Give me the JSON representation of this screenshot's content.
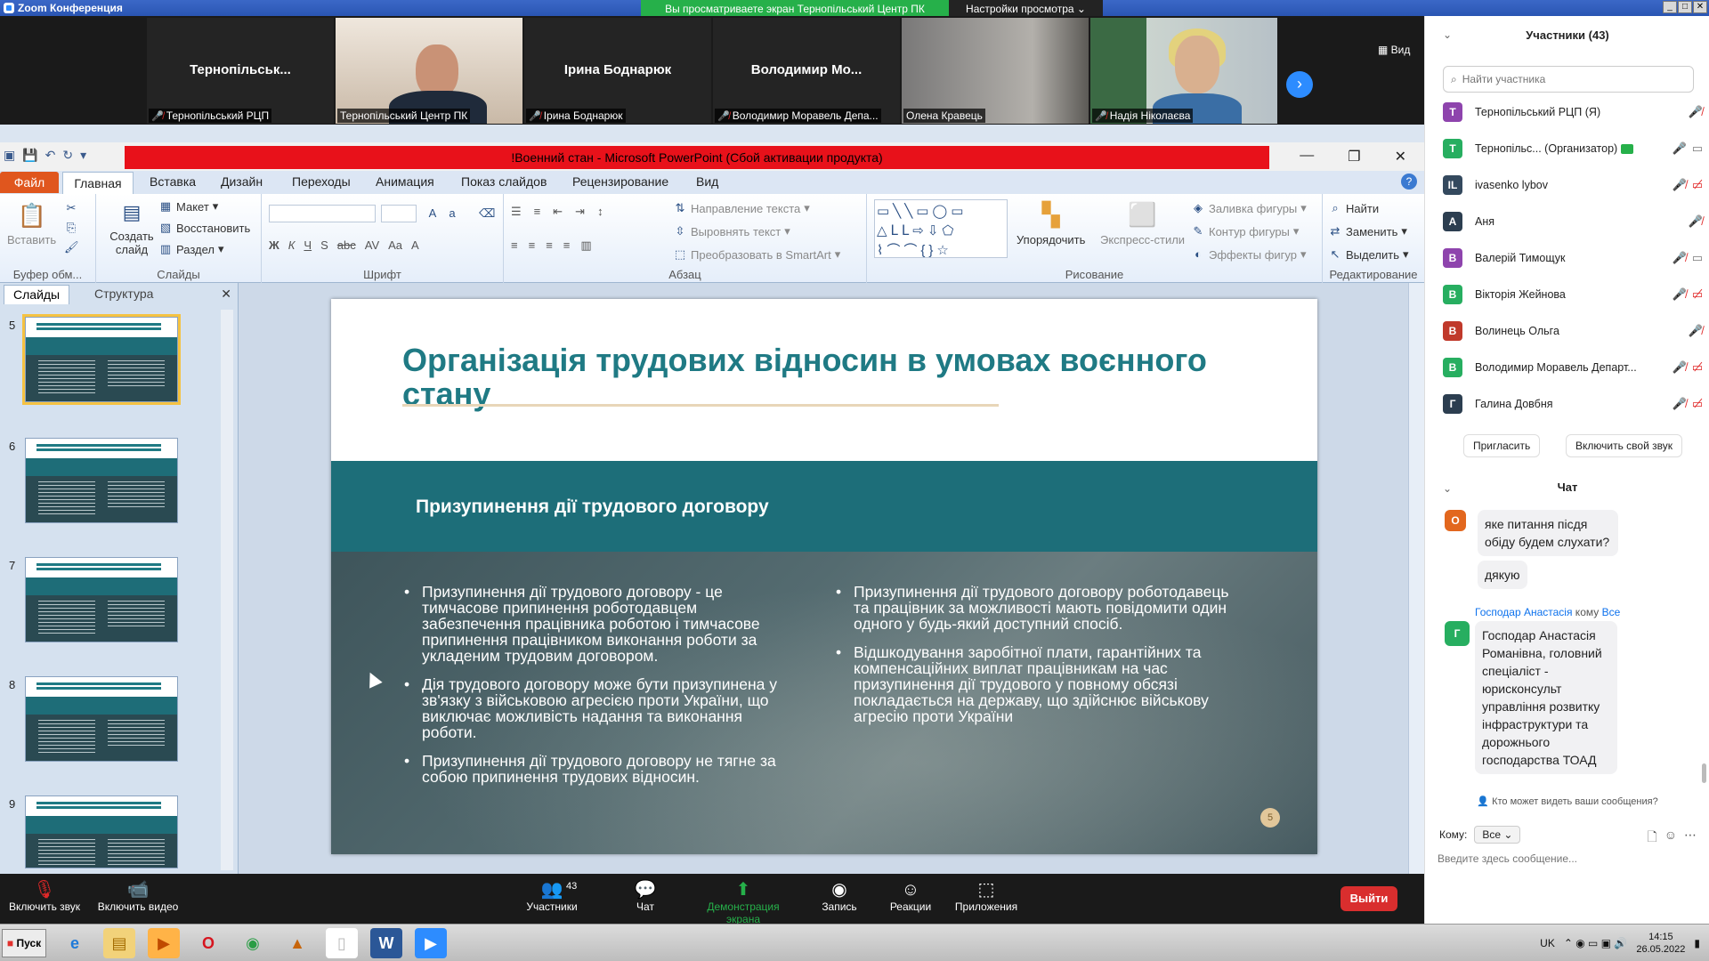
{
  "zoom": {
    "window_title": "Zoom Конференция",
    "share_banner": "Вы просматриваете экран Тернопільський Центр ПК",
    "view_options": "Настройки просмотра ⌄",
    "view_button": "Вид"
  },
  "video_tiles": [
    {
      "display_name": "Тернопільськ...",
      "label": "Тернопільський РЦП",
      "muted": true
    },
    {
      "display_name": "",
      "label": "Тернопільський Центр ПК",
      "muted": false
    },
    {
      "display_name": "Ірина Боднарюк",
      "label": "Ірина Боднарюк",
      "muted": true
    },
    {
      "display_name": "Володимир  Мо...",
      "label": "Володимир Моравель Депа...",
      "muted": true
    },
    {
      "display_name": "",
      "label": "Олена Кравець",
      "muted": false
    },
    {
      "display_name": "",
      "label": "Надія Ніколаєва",
      "muted": true
    }
  ],
  "ppt": {
    "title": "!Военний стан  -  Microsoft PowerPoint (Сбой активации продукта)",
    "tabs": [
      "Файл",
      "Главная",
      "Вставка",
      "Дизайн",
      "Переходы",
      "Анимация",
      "Показ слайдов",
      "Рецензирование",
      "Вид"
    ],
    "ribbon": {
      "clipboard": {
        "paste": "Вставить",
        "label": "Буфер обм..."
      },
      "slides": {
        "new_slide": "Создать слайд",
        "layout": "Макет",
        "reset": "Восстановить",
        "section": "Раздел",
        "label": "Слайды"
      },
      "font": {
        "label": "Шрифт"
      },
      "paragraph": {
        "text_direction": "Направление текста",
        "align_text": "Выровнять текст",
        "smartart": "Преобразовать в SmartArt",
        "label": "Абзац"
      },
      "drawing": {
        "arrange": "Упорядочить",
        "quick_styles": "Экспресс-стили",
        "shape_fill": "Заливка фигуры",
        "shape_outline": "Контур фигуры",
        "shape_effects": "Эффекты фигур",
        "label": "Рисование"
      },
      "editing": {
        "find": "Найти",
        "replace": "Заменить",
        "select": "Выделить",
        "label": "Редактирование"
      }
    },
    "pane": {
      "tab_slides": "Слайды",
      "tab_outline": "Структура",
      "close": "✕"
    },
    "thumbnails": [
      "5",
      "6",
      "7",
      "8",
      "9"
    ],
    "slide": {
      "title": "Організація трудових відносин в умовах воєнного стану",
      "subtitle": "Призупинення дії трудового договору",
      "left_bullets": [
        "Призупинення  дії трудового договору - це тимчасове припинення  роботодавцем забезпечення працівника роботою і тимчасове припинення  працівником виконання роботи за укладеним  трудовим договором.",
        "Дія трудового договору може бути призупинена  у зв'язку з військовою агресією проти України, що виключає можливість надання та виконання роботи.",
        "Призупинення  дії трудового договору не тягне за собою припинення  трудових  відносин."
      ],
      "right_bullets": [
        "Призупинення  дії трудового договору роботодавець та працівник за можливості мають повідомити один одного у будь-який  доступний спосіб.",
        "Відшкодування заробітної плати, гарантійних та компенсаційних  виплат працівникам на час призупинення  дії трудового у повному обсязі покладається на державу, що здійснює військову агресію проти України"
      ],
      "page_number": "5"
    }
  },
  "toolbar": {
    "unmute": "Включить звук",
    "start_video": "Включить видео",
    "participants": "Участники",
    "participants_count": "43",
    "chat": "Чат",
    "share_screen": "Демонстрация экрана",
    "record": "Запись",
    "reactions": "Реакции",
    "apps": "Приложения",
    "leave": "Выйти"
  },
  "participants_panel": {
    "title": "Участники (43)",
    "search_placeholder": "Найти участника",
    "list": [
      {
        "initial": "Т",
        "color": "#8e44ad",
        "name": "Тернопільський РЦП (Я)"
      },
      {
        "initial": "Т",
        "color": "#27ae60",
        "name": "Тернопільс... (Организатор)"
      },
      {
        "initial": "IL",
        "color": "#34495e",
        "name": "ivasenko lybov"
      },
      {
        "initial": "А",
        "color": "#2c3e50",
        "name": "Аня"
      },
      {
        "initial": "В",
        "color": "#8e44ad",
        "name": "Валерій Тимощук"
      },
      {
        "initial": "В",
        "color": "#27ae60",
        "name": "Вікторія Жейнова"
      },
      {
        "initial": "В",
        "color": "#c0392b",
        "name": "Волинець Ольга"
      },
      {
        "initial": "В",
        "color": "#27ae60",
        "name": "Володимир Моравель Департ..."
      },
      {
        "initial": "Г",
        "color": "#2c3e50",
        "name": "Галина Довбня"
      }
    ],
    "invite": "Пригласить",
    "unmute_me": "Включить свой звук"
  },
  "chat": {
    "title": "Чат",
    "messages": [
      {
        "avatar": "О",
        "color": "#e2671e",
        "text": "яке питання пісдя обіду будем слухати?"
      },
      {
        "text": "дякую"
      }
    ],
    "sender_line": {
      "from": "Господар Анастасія",
      "middle": " кому ",
      "to": "Все"
    },
    "last_message": {
      "avatar": "Г",
      "color": "#27ae60",
      "text": "Господар Анастасія Романівна, головний спеціаліст - юрисконсульт управління розвитку інфраструктури та дорожнього господарства ТОАД"
    },
    "who_can_see": "Кто может видеть ваши сообщения?",
    "to_label": "Кому:",
    "to_value": "Все",
    "input_placeholder": "Введите здесь сообщение..."
  },
  "taskbar": {
    "start": "Пуск",
    "lang": "UK",
    "time": "14:15",
    "date": "26.05.2022"
  }
}
